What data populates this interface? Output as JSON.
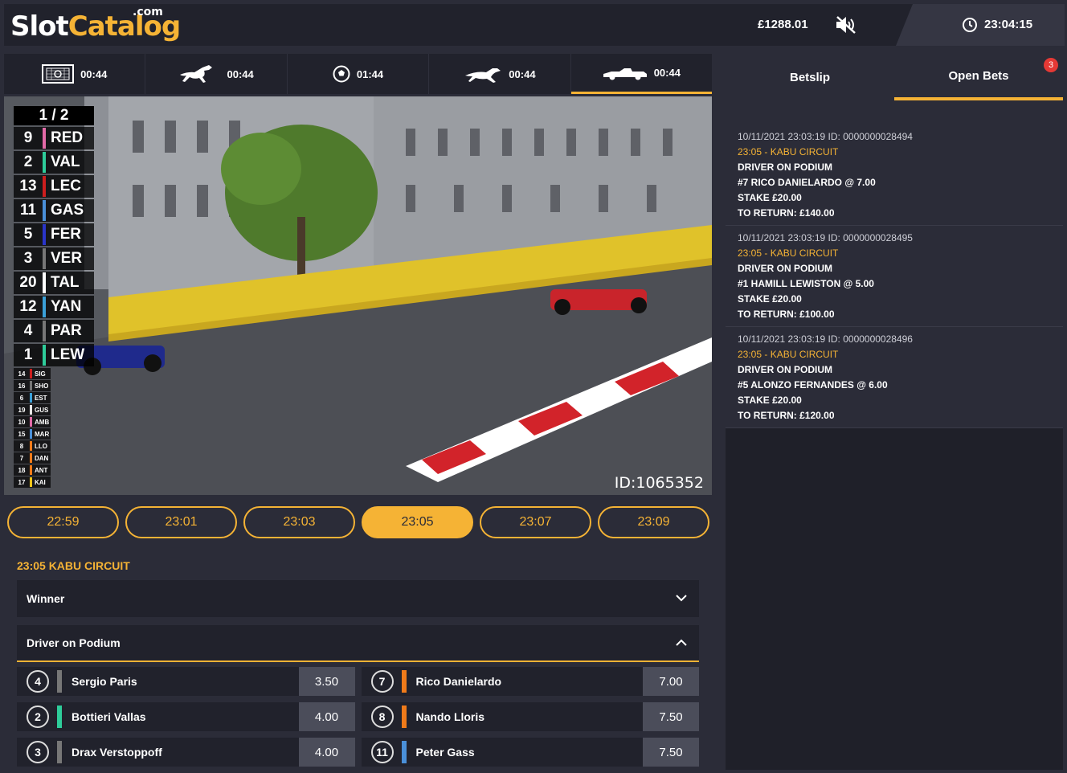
{
  "header": {
    "logo_slot": "Slot",
    "logo_catalog": "Catalog",
    "logo_com": ".com",
    "balance": "£1288.01",
    "mute_icon": "speaker-muted-icon",
    "clock_time": "23:04:15"
  },
  "sports": [
    {
      "icon": "keno-icon",
      "time": "00:44"
    },
    {
      "icon": "horse-icon",
      "time": "00:44"
    },
    {
      "icon": "football-icon",
      "time": "01:44"
    },
    {
      "icon": "greyhound-icon",
      "time": "00:44"
    },
    {
      "icon": "race-car-icon",
      "time": "00:44"
    }
  ],
  "video": {
    "lap": "1 / 2",
    "leaders": [
      {
        "num": "9",
        "abbr": "RED",
        "color": "#e36aa8"
      },
      {
        "num": "2",
        "abbr": "VAL",
        "color": "#2ecc9a"
      },
      {
        "num": "13",
        "abbr": "LEC",
        "color": "#cc1e1e"
      },
      {
        "num": "11",
        "abbr": "GAS",
        "color": "#4a90d9"
      },
      {
        "num": "5",
        "abbr": "FER",
        "color": "#2a35c9"
      },
      {
        "num": "3",
        "abbr": "VER",
        "color": "#777777"
      },
      {
        "num": "20",
        "abbr": "TAL",
        "color": "#ffffff"
      },
      {
        "num": "12",
        "abbr": "YAN",
        "color": "#3aa0d8"
      },
      {
        "num": "4",
        "abbr": "PAR",
        "color": "#777777"
      },
      {
        "num": "1",
        "abbr": "LEW",
        "color": "#2ecc9a"
      }
    ],
    "others": [
      {
        "num": "14",
        "abbr": "SIG",
        "color": "#cc1e1e"
      },
      {
        "num": "16",
        "abbr": "SHO",
        "color": "#777777"
      },
      {
        "num": "6",
        "abbr": "EST",
        "color": "#3aa0d8"
      },
      {
        "num": "19",
        "abbr": "GUS",
        "color": "#e8e8e8"
      },
      {
        "num": "10",
        "abbr": "AMB",
        "color": "#e36aa8"
      },
      {
        "num": "15",
        "abbr": "MAR",
        "color": "#4a90d9"
      },
      {
        "num": "8",
        "abbr": "LLO",
        "color": "#f07b1a"
      },
      {
        "num": "7",
        "abbr": "DAN",
        "color": "#f07b1a"
      },
      {
        "num": "18",
        "abbr": "ANT",
        "color": "#f07b1a"
      },
      {
        "num": "17",
        "abbr": "KAI",
        "color": "#f0c419"
      }
    ],
    "id_label": "ID:1065352"
  },
  "times": [
    "22:59",
    "23:01",
    "23:03",
    "23:05",
    "23:07",
    "23:09"
  ],
  "active_time": "23:05",
  "race_title": "23:05 KABU CIRCUIT",
  "markets": {
    "winner": "Winner",
    "podium": "Driver on Podium"
  },
  "runners": [
    {
      "num": "4",
      "name": "Sergio Paris",
      "odds": "3.50",
      "color": "#777777"
    },
    {
      "num": "7",
      "name": "Rico Danielardo",
      "odds": "7.00",
      "color": "#f07b1a"
    },
    {
      "num": "2",
      "name": "Bottieri Vallas",
      "odds": "4.00",
      "color": "#2ecc9a"
    },
    {
      "num": "8",
      "name": "Nando Lloris",
      "odds": "7.50",
      "color": "#f07b1a"
    },
    {
      "num": "3",
      "name": "Drax Verstoppoff",
      "odds": "4.00",
      "color": "#777777"
    },
    {
      "num": "11",
      "name": "Peter Gass",
      "odds": "7.50",
      "color": "#4a90d9"
    }
  ],
  "panel": {
    "tab_betslip": "Betslip",
    "tab_open": "Open Bets",
    "badge": "3",
    "bets": [
      {
        "meta": "10/11/2021 23:03:19 ID: 0000000028494",
        "race": "23:05 - KABU CIRCUIT",
        "market": "DRIVER ON PODIUM",
        "selection": "#7 RICO DANIELARDO @ 7.00",
        "stake": "STAKE £20.00",
        "ret": "TO RETURN: £140.00"
      },
      {
        "meta": "10/11/2021 23:03:19 ID: 0000000028495",
        "race": "23:05 - KABU CIRCUIT",
        "market": "DRIVER ON PODIUM",
        "selection": "#1 HAMILL LEWISTON @ 5.00",
        "stake": "STAKE £20.00",
        "ret": "TO RETURN: £100.00"
      },
      {
        "meta": "10/11/2021 23:03:19 ID: 0000000028496",
        "race": "23:05 - KABU CIRCUIT",
        "market": "DRIVER ON PODIUM",
        "selection": "#5 ALONZO FERNANDES @ 6.00",
        "stake": "STAKE £20.00",
        "ret": "TO RETURN: £120.00"
      }
    ]
  }
}
